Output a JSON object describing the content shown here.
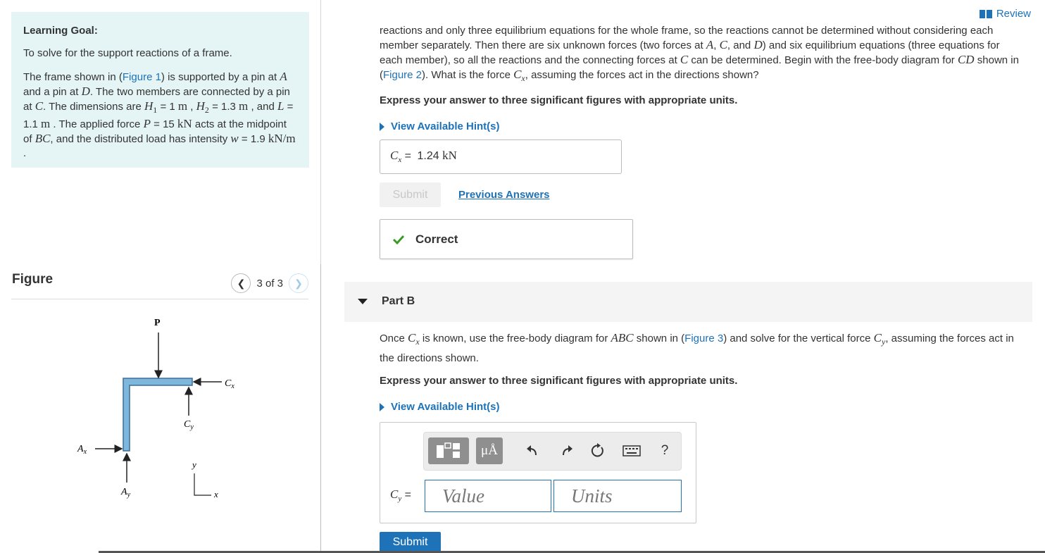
{
  "review": {
    "label": "Review"
  },
  "learning_goal": {
    "title": "Learning Goal:",
    "text": "To solve for the support reactions of a frame.",
    "p1": "The frame shown in (",
    "figure1_link": "Figure 1",
    "p2": ") is supported by a pin at ",
    "A": "A",
    "p3": " and a pin at ",
    "D": "D",
    "p4": ". The two members are connected by a pin at ",
    "C": "C",
    "p5": ". The dimensions are ",
    "H1": "H",
    "H1_sub": "1",
    "H1_val": " = 1 ",
    "unit_m": "m",
    "p6": " , ",
    "H2": "H",
    "H2_sub": "2",
    "H2_val": " = 1.3 ",
    "p7": " , and ",
    "L": "L",
    "L_val": " = 1.1 ",
    "p8": " . The applied force ",
    "P": "P",
    "P_val": " = 15 ",
    "unit_kN": "kN",
    "p9": " acts at the midpoint of ",
    "BC": "BC",
    "p10": ", and the distributed load has intensity ",
    "w": "w",
    "w_val": " = 1.9 ",
    "unit_kNm": "kN/m",
    "p11": " ."
  },
  "figure": {
    "title": "Figure",
    "pager": "3 of 3",
    "prev_icon": "chevron-left-icon",
    "next_icon": "chevron-right-icon",
    "labels": {
      "P": "P",
      "Cx": "C",
      "Cx_sub": "x",
      "Cy": "C",
      "Cy_sub": "y",
      "Ax": "A",
      "Ax_sub": "x",
      "Ay": "A",
      "Ay_sub": "y",
      "axis_y": "y",
      "axis_x": "x"
    },
    "member_color": "#7fb7dc"
  },
  "partA": {
    "t1": "reactions and only three equilibrium equations for the whole frame, so the reactions cannot be determined without considering each member separately. Then there are six unknown forces (two forces at ",
    "A": "A",
    "t2": ", ",
    "C": "C",
    "t3": ", and ",
    "D": "D",
    "t4": ") and six equilibrium equations (three equations for each member), so all the reactions and the connecting forces at ",
    "t5": " can be determined. Begin with the free-body diagram for ",
    "CD": "CD",
    "t6": " shown in (",
    "figure2_link": "Figure 2",
    "t7": "). What is the force ",
    "Cx": "C",
    "Cx_sub": "x",
    "t8": ", assuming the forces act in the directions shown?",
    "instruction": "Express your answer to three significant figures with appropriate units.",
    "hint": "View Available Hint(s)",
    "answer_var": "C",
    "answer_sub": "x",
    "answer_eq": " = ",
    "answer_value": "1.24",
    "answer_unit": "kN",
    "submit": "Submit",
    "previous_answers": "Previous Answers",
    "status": "Correct",
    "status_color": "#3a9d23"
  },
  "partB": {
    "label": "Part B",
    "t1": "Once ",
    "Cx": "C",
    "Cx_sub": "x",
    "t2": " is known, use the free-body diagram for ",
    "ABC": "ABC",
    "t3": " shown in (",
    "figure3_link": "Figure 3",
    "t4": ") and solve for the vertical force ",
    "Cy": "C",
    "Cy_sub": "y",
    "t5": ", assuming the forces act in the directions shown.",
    "instruction": "Express your answer to three significant figures with appropriate units.",
    "hint": "View Available Hint(s)",
    "input_var": "C",
    "input_sub": "y",
    "input_eq": " =",
    "value_placeholder": "Value",
    "units_placeholder": "Units",
    "units_button": "μÅ",
    "help_button": "?",
    "submit": "Submit"
  }
}
